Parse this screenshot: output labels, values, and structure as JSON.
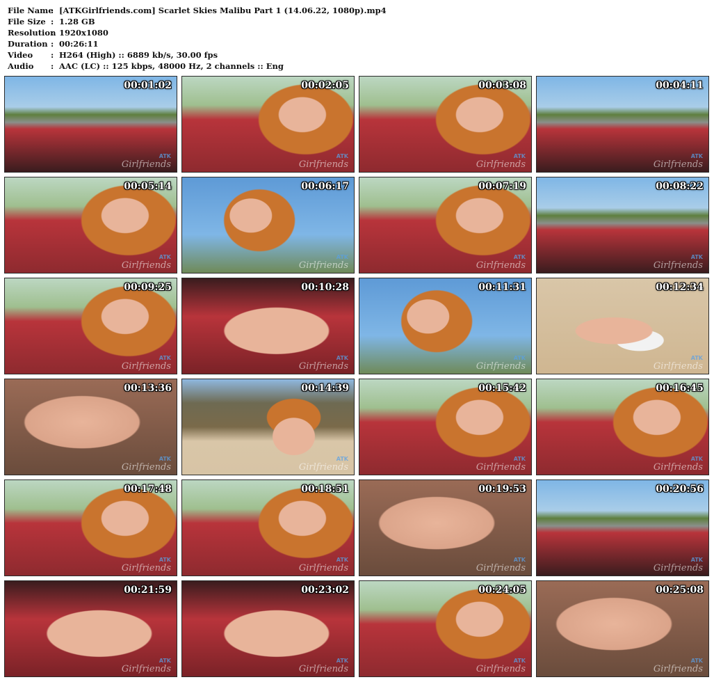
{
  "info": [
    {
      "label": "File Name",
      "value": "[ATKGirlfriends.com] Scarlet Skies Malibu Part 1 (14.06.22, 1080p).mp4"
    },
    {
      "label": "File Size",
      "value": "1.28 GB"
    },
    {
      "label": "Resolution",
      "value": "1920x1080"
    },
    {
      "label": "Duration",
      "value": "00:26:11"
    },
    {
      "label": "Video",
      "value": "H264 (High) :: 6889 kb/s, 30.00 fps"
    },
    {
      "label": "Audio",
      "value": "AAC (LC) :: 125 kbps, 48000 Hz, 2 channels :: Eng"
    }
  ],
  "separator": ":",
  "watermark": {
    "top": "ATK",
    "bottom": "Girlfriends"
  },
  "thumbnails": [
    {
      "time": "00:01:02",
      "scene": "car-road"
    },
    {
      "time": "00:02:05",
      "scene": "car-person"
    },
    {
      "time": "00:03:08",
      "scene": "car-person"
    },
    {
      "time": "00:04:11",
      "scene": "car-road"
    },
    {
      "time": "00:05:14",
      "scene": "car-person"
    },
    {
      "time": "00:06:17",
      "scene": "sky-person"
    },
    {
      "time": "00:07:19",
      "scene": "car-person"
    },
    {
      "time": "00:08:22",
      "scene": "car-road"
    },
    {
      "time": "00:09:25",
      "scene": "car-person"
    },
    {
      "time": "00:10:28",
      "scene": "car-closeup"
    },
    {
      "time": "00:11:31",
      "scene": "sky-person"
    },
    {
      "time": "00:12:34",
      "scene": "beach"
    },
    {
      "time": "00:13:36",
      "scene": "closeup"
    },
    {
      "time": "00:14:39",
      "scene": "beach-hill"
    },
    {
      "time": "00:15:42",
      "scene": "car-person"
    },
    {
      "time": "00:16:45",
      "scene": "car-person"
    },
    {
      "time": "00:17:48",
      "scene": "car-person"
    },
    {
      "time": "00:18:51",
      "scene": "car-person"
    },
    {
      "time": "00:19:53",
      "scene": "closeup"
    },
    {
      "time": "00:20:56",
      "scene": "car-road"
    },
    {
      "time": "00:21:59",
      "scene": "car-closeup"
    },
    {
      "time": "00:23:02",
      "scene": "car-closeup"
    },
    {
      "time": "00:24:05",
      "scene": "car-person"
    },
    {
      "time": "00:25:08",
      "scene": "closeup"
    }
  ],
  "colors": {
    "sky": "#7fb6e6",
    "interior_red": "#b8343b",
    "dash_dark": "#3a1c1e",
    "skin": "#e8b49a",
    "hair": "#c9742e",
    "sand": "#d9c6a8",
    "foliage": "#5e7f3f"
  }
}
